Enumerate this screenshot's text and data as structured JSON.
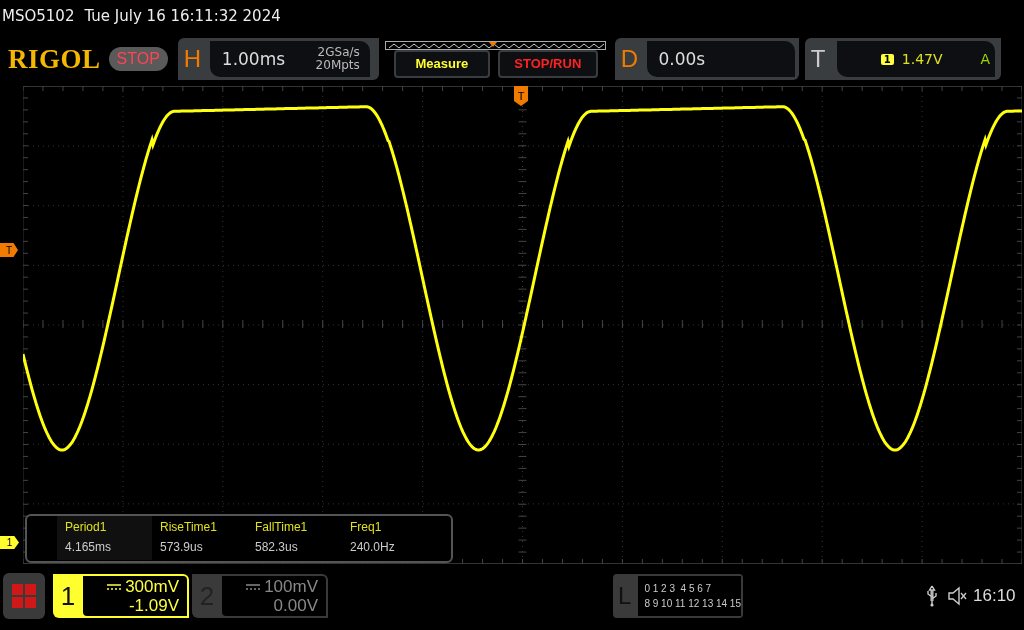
{
  "header": {
    "model": "MSO5102",
    "datetime": "Tue July 16 16:11:32 2024"
  },
  "toolbar": {
    "logo": "RIGOL",
    "run_state": "STOP",
    "horizontal": {
      "label": "H",
      "timebase": "1.00ms",
      "sample_rate": "2GSa/s",
      "memory_depth": "20Mpts"
    },
    "buttons": [
      {
        "label": "Measure",
        "kind": "menu"
      },
      {
        "label": "STOP/RUN",
        "kind": "run"
      }
    ],
    "delay": {
      "label": "D",
      "value": "0.00s"
    },
    "trigger": {
      "label": "T",
      "source": "1",
      "level": "1.47V",
      "mode": "A"
    }
  },
  "markers": {
    "trigger_position": "T",
    "trigger_level": "T",
    "channel": "1"
  },
  "measurements": [
    {
      "name": "Period1",
      "value": "4.165ms"
    },
    {
      "name": "RiseTime1",
      "value": "573.9us"
    },
    {
      "name": "FallTime1",
      "value": "582.3us"
    },
    {
      "name": "Freq1",
      "value": "240.0Hz"
    }
  ],
  "channels": [
    {
      "number": "1",
      "scale": "300mV",
      "offset": "-1.09V",
      "selected": true
    },
    {
      "number": "2",
      "scale": "100mV",
      "offset": "0.00V",
      "selected": false
    }
  ],
  "logic": {
    "label": "L",
    "row_1": "0 1 2 3  4 5 6 7",
    "row_2": "8 9 10 11 12 13 14 15"
  },
  "status": {
    "time": "16:10"
  }
}
